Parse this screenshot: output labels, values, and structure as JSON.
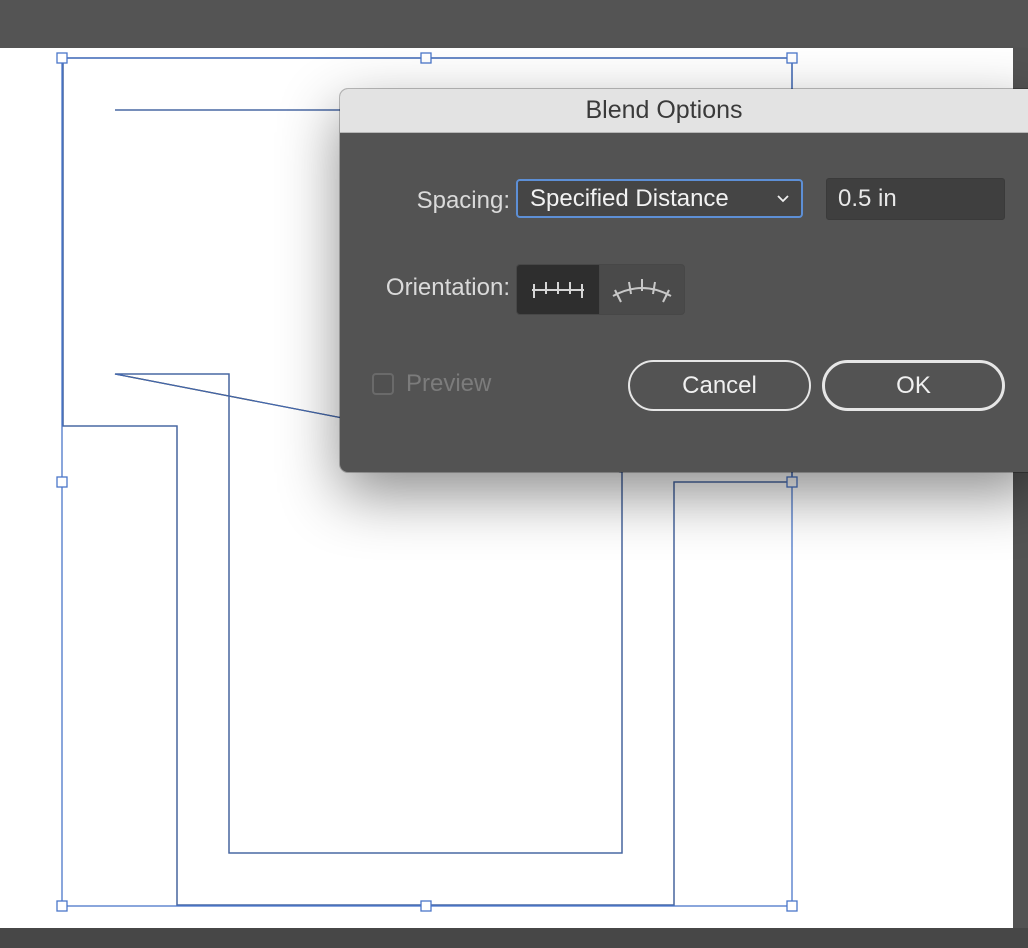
{
  "dialog": {
    "title": "Blend Options",
    "spacing": {
      "label": "Spacing:",
      "selected": "Specified Distance",
      "value": "0.5 in"
    },
    "orientation": {
      "label": "Orientation:",
      "options": [
        "align-to-page-icon",
        "align-to-path-icon"
      ],
      "selected_index": 0
    },
    "preview": {
      "label": "Preview",
      "checked": false
    },
    "buttons": {
      "cancel": "Cancel",
      "ok": "OK"
    }
  },
  "colors": {
    "selection": "#4a76c9",
    "dialog_bg": "#535353",
    "focus_ring": "#5d8fd6"
  }
}
